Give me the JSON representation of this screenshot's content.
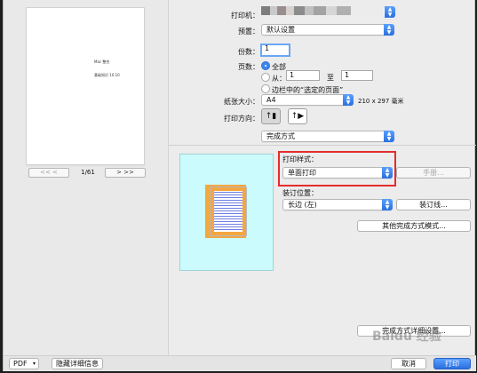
{
  "preview": {
    "thumb_title_lines": [
      "Mac 整合",
      "基础知识 10.10"
    ],
    "prev_label": "<<   <",
    "page_indicator": "1/61",
    "next_label": ">   >>"
  },
  "printer": {
    "label": "打印机："
  },
  "presets": {
    "label": "预置：",
    "value": "默认设置"
  },
  "copies": {
    "label": "份数：",
    "value": "1"
  },
  "pages": {
    "label": "页数：",
    "all_label": "全部",
    "from_label": "从：",
    "from_value": "1",
    "to_label": "至",
    "to_value": "1",
    "selection_label": "边栏中的“选定的页面”"
  },
  "paper": {
    "label": "纸张大小：",
    "value": "A4",
    "dimensions": "210 x 297 毫米"
  },
  "orientation": {
    "label": "打印方向："
  },
  "section": {
    "value": "完成方式"
  },
  "finishing": {
    "print_style_label": "打印样式：",
    "print_style_value": "单面打印",
    "manual_button": "手册...",
    "binding_label": "装订位置：",
    "binding_value": "长边 (左)",
    "binding_line_button": "装订线...",
    "other_button": "其他完成方式模式...",
    "detail_button": "完成方式详细设置..."
  },
  "bottom": {
    "pdf": "PDF",
    "hide_details": "隐藏详细信息",
    "cancel": "取消",
    "print": "打印"
  },
  "watermark": "Baidu 经验",
  "colors": {
    "accent": "#3d86f0",
    "highlight": "#e52c2c",
    "preview_bg": "#ccfbfd"
  }
}
